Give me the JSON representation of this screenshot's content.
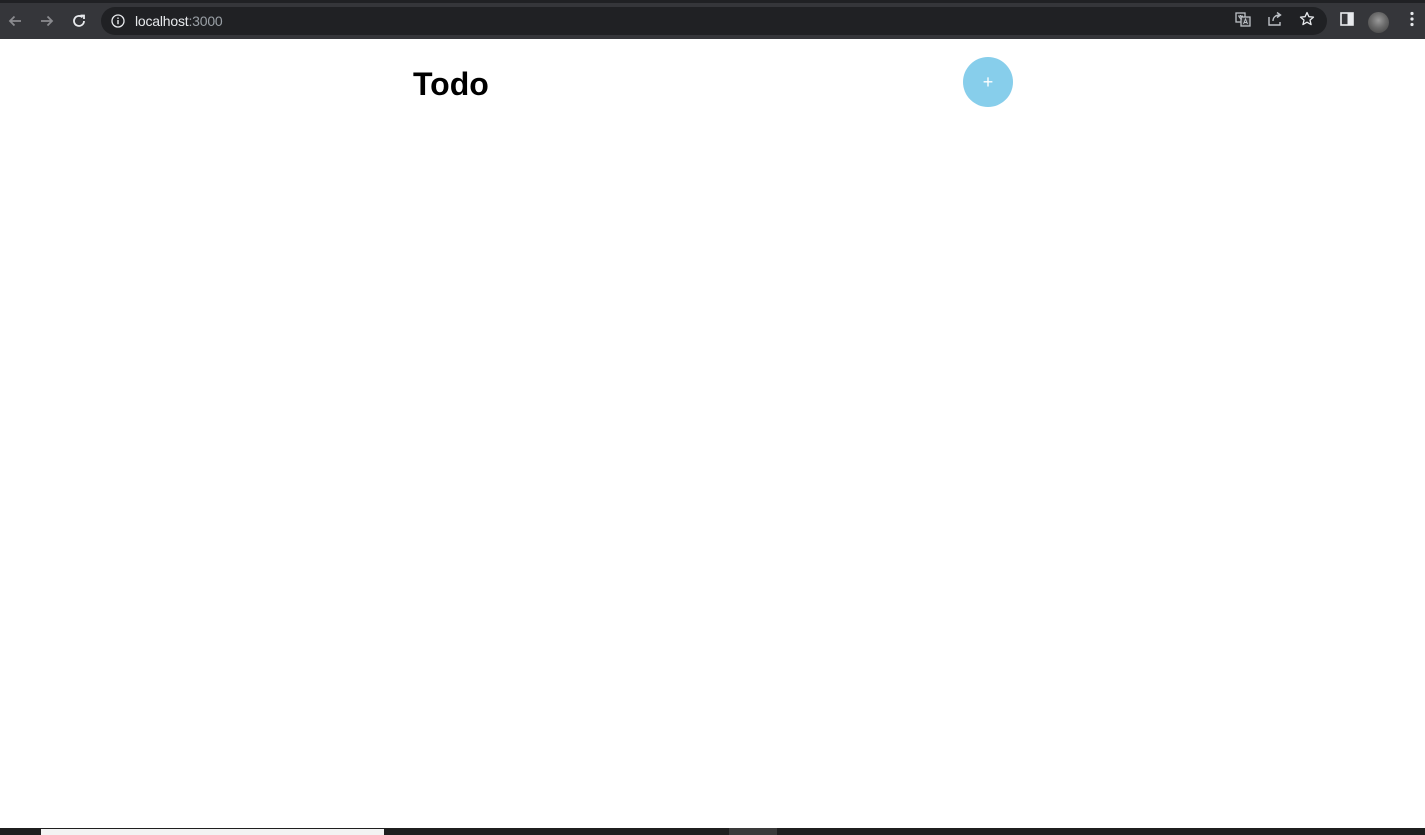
{
  "browser": {
    "url_host": "localhost",
    "url_port": ":3000",
    "icons": {
      "back": "arrow-left-icon",
      "forward": "arrow-right-icon",
      "reload": "reload-icon",
      "site_info": "info-icon",
      "translate": "translate-icon",
      "share": "share-icon",
      "bookmark": "star-icon",
      "side_panel": "side-panel-icon",
      "profile": "avatar",
      "menu": "kebab-menu-icon"
    }
  },
  "page": {
    "title": "Todo",
    "add_button_label": "+"
  },
  "colors": {
    "chrome_bar": "#35363a",
    "omnibox": "#202124",
    "add_button": "#87ceeb",
    "page_background": "#ffffff"
  }
}
